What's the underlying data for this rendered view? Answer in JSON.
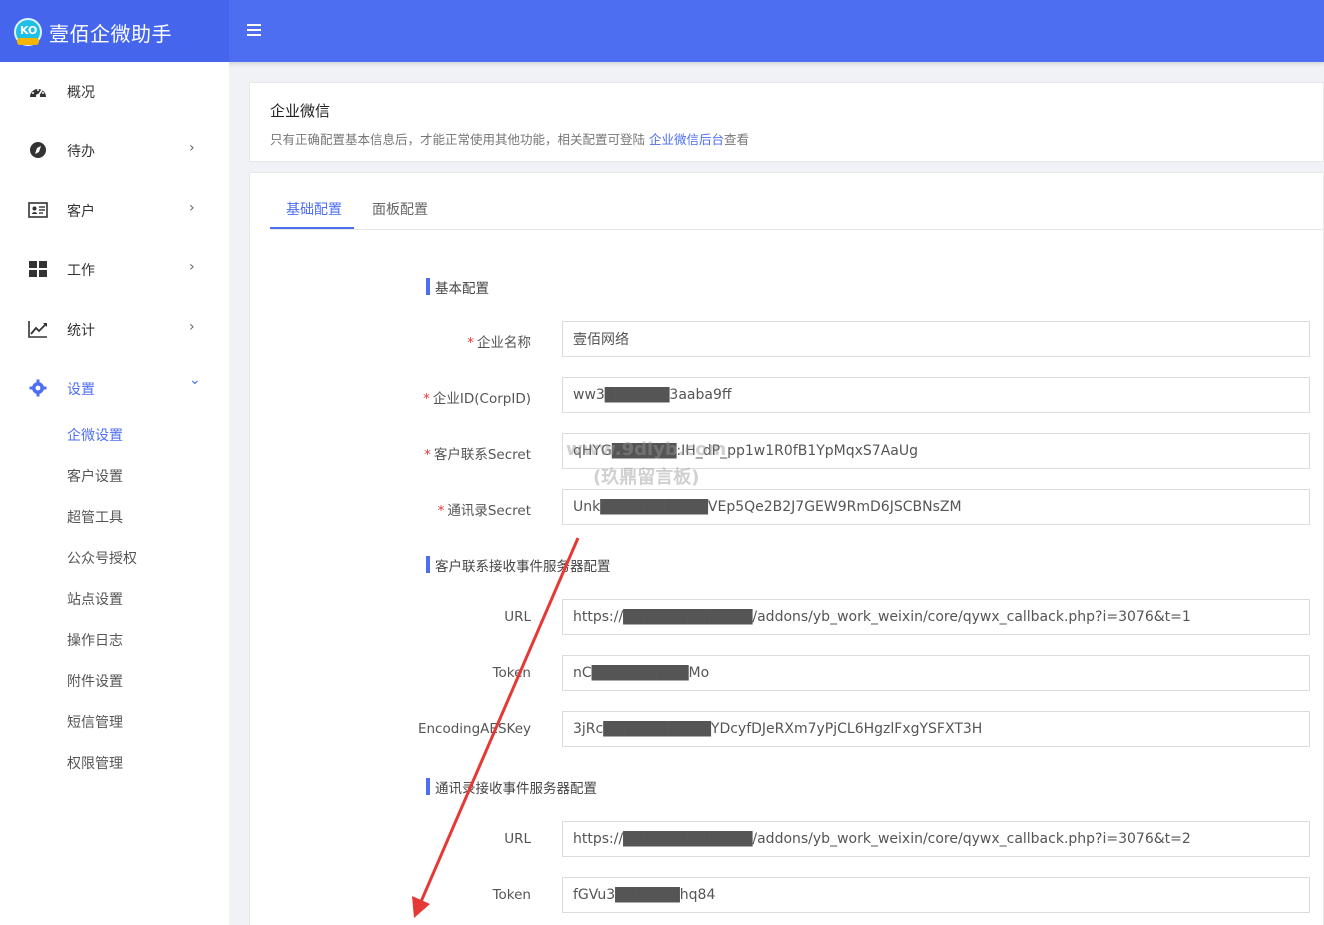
{
  "app": {
    "title": "壹佰企微助手",
    "logo_text": "KO"
  },
  "sidebar": {
    "items": [
      {
        "label": "概况",
        "icon": "dashboard-icon"
      },
      {
        "label": "待办",
        "icon": "compass-icon",
        "chevron": "›"
      },
      {
        "label": "客户",
        "icon": "contact-card-icon",
        "chevron": "›"
      },
      {
        "label": "工作",
        "icon": "grid-icon",
        "chevron": "›"
      },
      {
        "label": "统计",
        "icon": "chart-line-icon",
        "chevron": "›"
      },
      {
        "label": "设置",
        "icon": "gear-icon",
        "chevron": "⌄"
      }
    ],
    "sub_items": [
      "企微设置",
      "客户设置",
      "超管工具",
      "公众号授权",
      "站点设置",
      "操作日志",
      "附件设置",
      "短信管理",
      "权限管理"
    ]
  },
  "info_card": {
    "title": "企业微信",
    "desc_before": "只有正确配置基本信息后，才能正常使用其他功能，相关配置可登陆 ",
    "link_text": "企业微信后台",
    "desc_after": "查看"
  },
  "tabs": [
    "基础配置",
    "面板配置"
  ],
  "sections": {
    "basic": "基本配置",
    "customer_event": "客户联系接收事件服务器配置",
    "contact_event": "通讯录接收事件服务器配置"
  },
  "fields": {
    "corp_name": {
      "label": "企业名称",
      "value": "壹佰网络"
    },
    "corp_id": {
      "label": "企业ID(CorpID)",
      "value": "ww3██████3aaba9ff"
    },
    "customer_secret": {
      "label": "客户联系Secret",
      "value": "qHYG██████:IH_dP_pp1w1R0fB1YpMqxS7AaUg"
    },
    "contact_secret": {
      "label": "通讯录Secret",
      "value": "Unk██████████VEp5Qe2B2J7GEW9RmD6JSCBNsZM"
    },
    "customer_url": {
      "label": "URL",
      "value": "https://████████████/addons/yb_work_weixin/core/qywx_callback.php?i=3076&t=1"
    },
    "customer_token": {
      "label": "Token",
      "value": "nC█████████Mo"
    },
    "customer_aeskey": {
      "label": "EncodingAESKey",
      "value": "3jRc██████████YDcyfDJeRXm7yPjCL6HgzlFxgYSFXT3H"
    },
    "contact_url": {
      "label": "URL",
      "value": "https://████████████/addons/yb_work_weixin/core/qywx_callback.php?i=3076&t=2"
    },
    "contact_token": {
      "label": "Token",
      "value": "fGVu3██████hq84"
    }
  },
  "watermark": {
    "line1": "www.9dlyb.com",
    "line2": "(玖鼎留言板)"
  },
  "colors": {
    "primary": "#4e6ef2",
    "header": "#4e6ef2",
    "required": "#e53935",
    "arrow": "#e53935"
  }
}
